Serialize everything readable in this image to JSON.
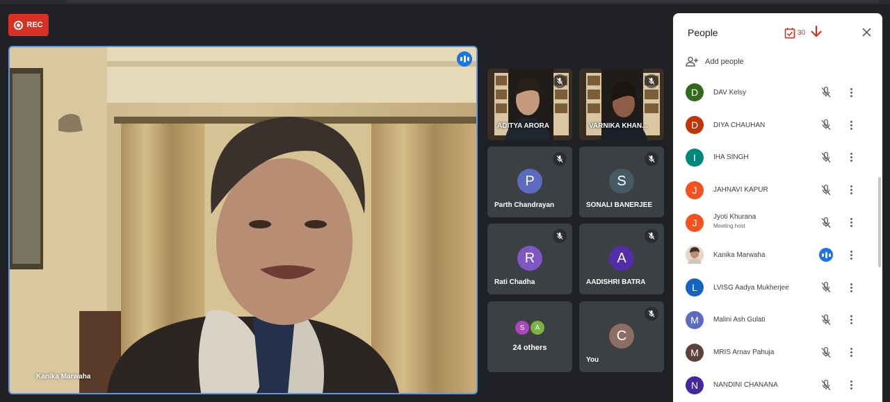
{
  "recording": {
    "label": "REC",
    "color": "#d93025"
  },
  "main_video": {
    "participant_name": "Kanika Marwaha",
    "speaking": true
  },
  "tiles": [
    {
      "name": "ADITYA ARORA",
      "kind": "video",
      "muted": true
    },
    {
      "name": "VARNIKA KHAN...",
      "kind": "video",
      "muted": true
    },
    {
      "name": "Parth Chandrayan",
      "kind": "avatar",
      "initial": "P",
      "color": "#5c6bc0",
      "muted": true
    },
    {
      "name": "SONALI BANERJEE",
      "kind": "avatar",
      "initial": "S",
      "color": "#455a64",
      "muted": true
    },
    {
      "name": "Rati Chadha",
      "kind": "avatar",
      "initial": "R",
      "color": "#7e57c2",
      "muted": true
    },
    {
      "name": "AADISHRI BATRA",
      "kind": "avatar",
      "initial": "A",
      "color": "#512da8",
      "muted": true
    },
    {
      "name": "You",
      "kind": "avatar",
      "initial": "C",
      "color": "#8d6e63",
      "muted": true
    }
  ],
  "others_tile": {
    "label": "24 others",
    "avatars": [
      {
        "initial": "S",
        "color": "#ab47bc"
      },
      {
        "initial": "A",
        "color": "#7cb342"
      }
    ]
  },
  "people_panel": {
    "title": "People",
    "count": "30",
    "add_people_label": "Add people",
    "people": [
      {
        "initial": "D",
        "color": "#33691e",
        "name": "DAV Kelsy",
        "sub": "",
        "state": "muted"
      },
      {
        "initial": "D",
        "color": "#bf360c",
        "name": "DIYA CHAUHAN",
        "sub": "",
        "state": "muted"
      },
      {
        "initial": "I",
        "color": "#00897b",
        "name": "IHA SINGH",
        "sub": "",
        "state": "muted"
      },
      {
        "initial": "J",
        "color": "#f4511e",
        "name": "JAHNAVI KAPUR",
        "sub": "",
        "state": "muted"
      },
      {
        "initial": "J",
        "color": "#f4511e",
        "name": "Jyoti Khurana",
        "sub": "Meeting host",
        "state": "muted"
      },
      {
        "initial": "",
        "color": "#c9a58a",
        "name": "Kanika Marwaha",
        "sub": "",
        "state": "speaking"
      },
      {
        "initial": "L",
        "color": "#1565c0",
        "name": "LVISG Aadya Mukherjee",
        "sub": "",
        "state": "muted"
      },
      {
        "initial": "M",
        "color": "#5c6bc0",
        "name": "Malini Ash Gulati",
        "sub": "",
        "state": "muted"
      },
      {
        "initial": "M",
        "color": "#5d4037",
        "name": "MRIS Arnav Pahuja",
        "sub": "",
        "state": "muted"
      },
      {
        "initial": "N",
        "color": "#4527a0",
        "name": "NANDINI CHANANA",
        "sub": "",
        "state": "muted"
      }
    ]
  }
}
